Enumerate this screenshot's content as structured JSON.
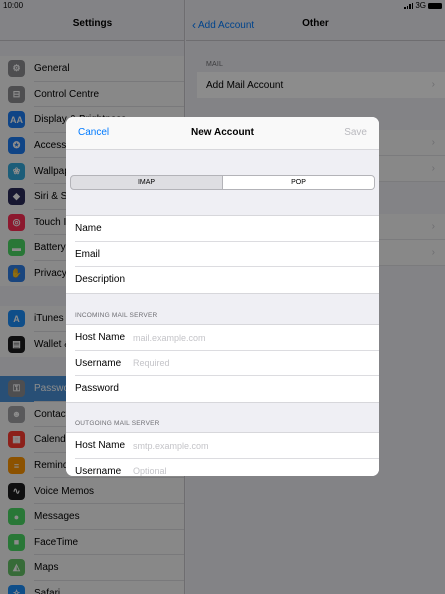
{
  "status": {
    "time": "10:00",
    "network": "3G"
  },
  "sidebar": {
    "title": "Settings",
    "groups": [
      [
        {
          "label": "General",
          "icon": "gear-icon",
          "glyph": "⚙",
          "color": "#8e8e93"
        },
        {
          "label": "Control Centre",
          "icon": "control-centre-icon",
          "glyph": "⊟",
          "color": "#8e8e93"
        },
        {
          "label": "Display & Brightness",
          "icon": "display-icon",
          "glyph": "AA",
          "color": "#1c7cf4"
        },
        {
          "label": "Accessibility",
          "icon": "accessibility-icon",
          "glyph": "✪",
          "color": "#1c7cf4"
        },
        {
          "label": "Wallpaper",
          "icon": "wallpaper-icon",
          "glyph": "❀",
          "color": "#34aadc"
        },
        {
          "label": "Siri & Search",
          "icon": "siri-icon",
          "glyph": "◆",
          "color": "#2b2b5a"
        },
        {
          "label": "Touch ID & Passcode",
          "icon": "fingerprint-icon",
          "glyph": "◎",
          "color": "#ff2d55"
        },
        {
          "label": "Battery",
          "icon": "battery-icon",
          "glyph": "▬",
          "color": "#4cd964"
        },
        {
          "label": "Privacy",
          "icon": "hand-icon",
          "glyph": "✋",
          "color": "#2f7ee6"
        }
      ],
      [
        {
          "label": "iTunes & App Store",
          "icon": "app-store-icon",
          "glyph": "A",
          "color": "#1c8ef9"
        },
        {
          "label": "Wallet & Apple Pay",
          "icon": "wallet-icon",
          "glyph": "▤",
          "color": "#1c1c1e"
        }
      ],
      [
        {
          "label": "Passwords & Accounts",
          "icon": "key-icon",
          "glyph": "⚿",
          "color": "#8e8e93",
          "selected": true
        },
        {
          "label": "Contacts",
          "icon": "contacts-icon",
          "glyph": "☻",
          "color": "#a2a2a6"
        },
        {
          "label": "Calendar",
          "icon": "calendar-icon",
          "glyph": "▦",
          "color": "#ff3b30"
        },
        {
          "label": "Reminders",
          "icon": "reminders-icon",
          "glyph": "≡",
          "color": "#ff9500"
        },
        {
          "label": "Voice Memos",
          "icon": "voice-memos-icon",
          "glyph": "∿",
          "color": "#1c1c1e"
        },
        {
          "label": "Messages",
          "icon": "messages-icon",
          "glyph": "●",
          "color": "#4cd964"
        },
        {
          "label": "FaceTime",
          "icon": "facetime-icon",
          "glyph": "■",
          "color": "#4cd964"
        },
        {
          "label": "Maps",
          "icon": "maps-icon",
          "glyph": "◭",
          "color": "#65c466"
        },
        {
          "label": "Safari",
          "icon": "safari-icon",
          "glyph": "✧",
          "color": "#1c8ef9"
        }
      ]
    ]
  },
  "detail": {
    "back_label": "Add Account",
    "title": "Other",
    "mail_header": "MAIL",
    "add_mail": "Add Mail Account"
  },
  "modal": {
    "cancel": "Cancel",
    "title": "New Account",
    "save": "Save",
    "segments": [
      "IMAP",
      "POP"
    ],
    "selected_segment": "POP",
    "account_fields": [
      {
        "label": "Name",
        "placeholder": ""
      },
      {
        "label": "Email",
        "placeholder": ""
      },
      {
        "label": "Description",
        "placeholder": ""
      }
    ],
    "incoming_header": "INCOMING MAIL SERVER",
    "incoming_fields": [
      {
        "label": "Host Name",
        "placeholder": "mail.example.com"
      },
      {
        "label": "Username",
        "placeholder": "Required"
      },
      {
        "label": "Password",
        "placeholder": ""
      }
    ],
    "outgoing_header": "OUTGOING MAIL SERVER",
    "outgoing_fields": [
      {
        "label": "Host Name",
        "placeholder": "smtp.example.com"
      },
      {
        "label": "Username",
        "placeholder": "Optional"
      }
    ]
  }
}
